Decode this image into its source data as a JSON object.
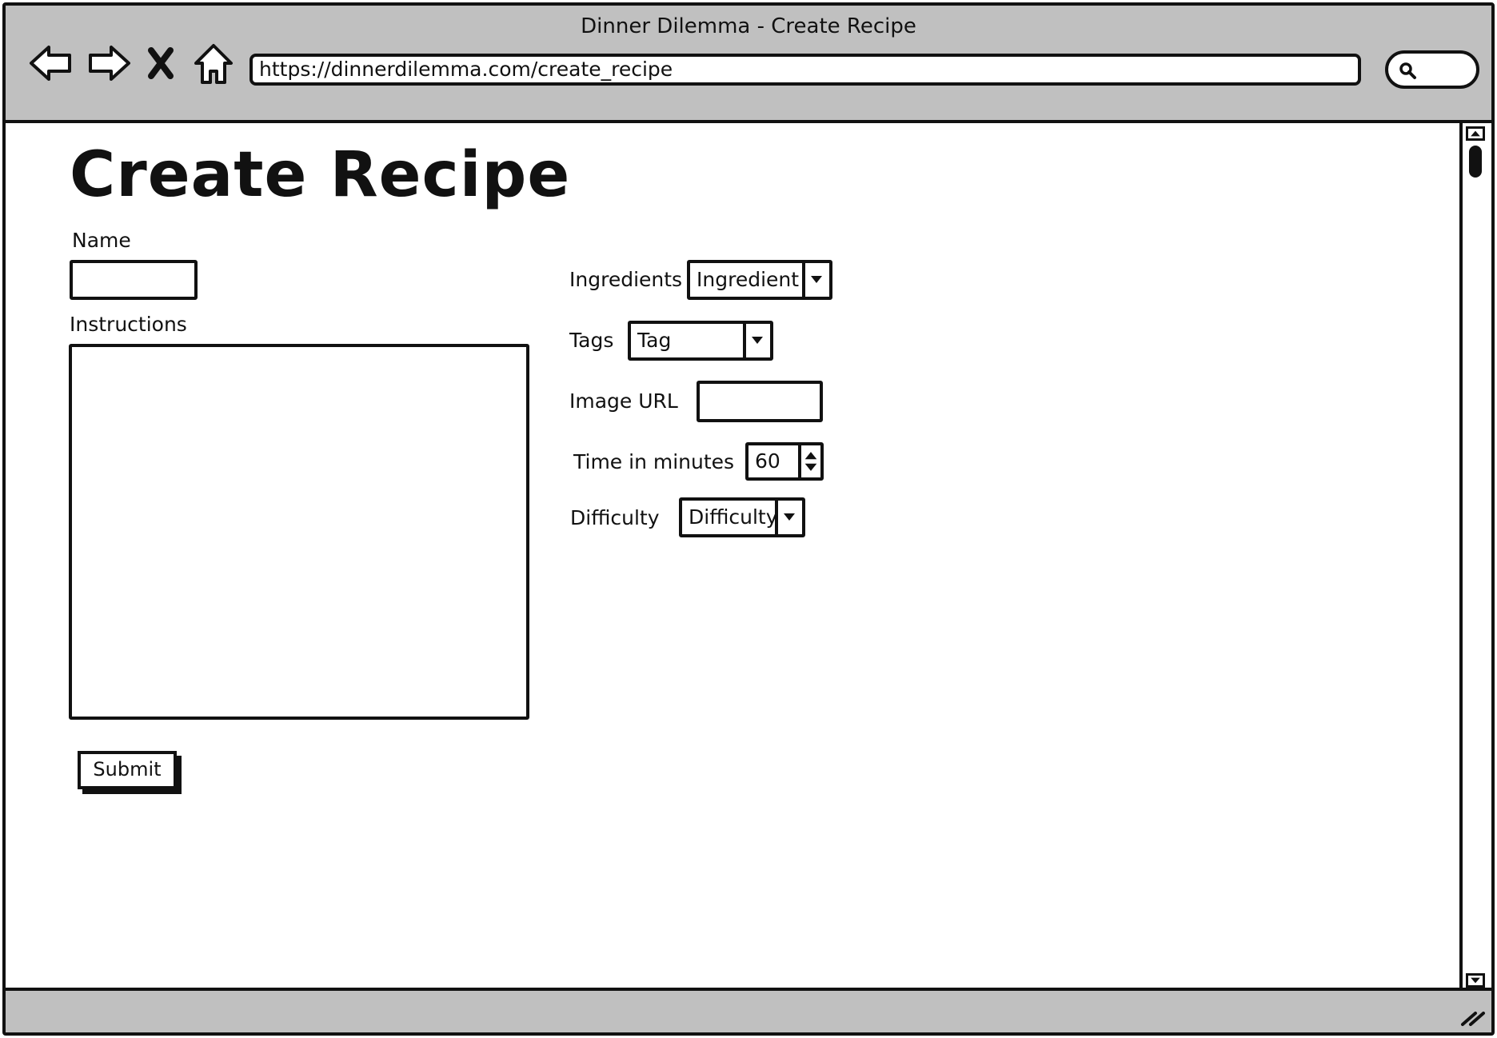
{
  "window": {
    "title": "Dinner Dilemma - Create Recipe"
  },
  "browser": {
    "url": "https://dinnerdilemma.com/create_recipe",
    "back_icon": "back-arrow-icon",
    "forward_icon": "forward-arrow-icon",
    "stop_icon": "close-icon",
    "home_icon": "home-icon",
    "search_icon": "search-icon"
  },
  "page": {
    "title": "Create Recipe"
  },
  "form": {
    "name_label": "Name",
    "name_value": "",
    "instructions_label": "Instructions",
    "instructions_value": "",
    "ingredients_label": "Ingredients",
    "ingredients_selected": "Ingredient",
    "tags_label": "Tags",
    "tags_selected": "Tag",
    "image_url_label": "Image URL",
    "image_url_value": "",
    "time_label": "Time in minutes",
    "time_value": "60",
    "difficulty_label": "Difficulty",
    "difficulty_selected": "Difficulty",
    "submit_label": "Submit"
  },
  "colors": {
    "chrome": "#c0c0c0",
    "ink": "#111111",
    "background": "#ffffff"
  }
}
